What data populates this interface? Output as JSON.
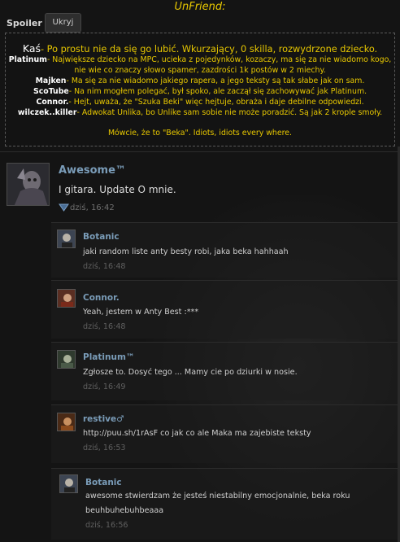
{
  "header": {
    "title": "UnFriend:"
  },
  "spoiler": {
    "label": "Spoiler",
    "button_label": "Ukryj",
    "lines": [
      {
        "name": "Kaś",
        "text": "- Po prostu nie da się go lubić. Wkurzający, 0 skilla, rozwydrzone dziecko."
      },
      {
        "name": "Platinum",
        "text": "- Największe dziecko na MPC, ucieka z pojedynków, kozaczy, ma się za nie wiadomo kogo,"
      },
      {
        "name": "",
        "text": "nie wie co znaczy słowo spamer, zazdrości 1k postów w 2 miechy."
      },
      {
        "name": "Majken",
        "text": "- Ma się za nie wiadomo jakiego rapera, a jego teksty są tak słabe jak on sam."
      },
      {
        "name": "ScoTube",
        "text": "- Na nim mogłem polegać, był spoko, ale zaczął się zachowywać jak Platinum."
      },
      {
        "name": "Connor.",
        "text": "- Hejt, uważa, że \"Szuka Beki\" więc hejtuje, obraża i daje debilne odpowiedzi."
      },
      {
        "name": "wilczek..killer",
        "text": "- Adwokat Unlika, bo Unlike sam sobie nie może poradzić. Są jak 2 krople smoły."
      }
    ],
    "footer": "Mówcie, że to \"Beka\". Idiots, idiots every where."
  },
  "post": {
    "author": "Awesome™",
    "text": "I gitara. Update O mnie.",
    "time": "dziś, 16:42",
    "vote_icon": "vote-arrow-icon"
  },
  "comments": [
    {
      "author": "Botanic",
      "text": [
        "jaki random liste anty besty robi, jaka beka hahhaah"
      ],
      "time": "dziś, 16:48",
      "avatar_color": "#3c4452"
    },
    {
      "author": "Connor.",
      "text": [
        "Yeah, jestem w Anty Best :***"
      ],
      "time": "dziś, 16:48",
      "avatar_color": "#6a3a2a"
    },
    {
      "author": "Platinum™",
      "text": [
        "Zgłosze to. Dosyć tego ... Mamy cie po dziurki w nosie."
      ],
      "time": "dziś, 16:49",
      "avatar_color": "#3d4a3a"
    },
    {
      "author": "restive♂",
      "text": [
        "http://puu.sh/1rAsF co jak co ale Maka ma zajebiste teksty"
      ],
      "time": "dziś, 16:53",
      "avatar_color": "#5a3a22"
    },
    {
      "author": "Botanic",
      "text": [
        "awesome stwierdzam że jesteś niestabilny emocjonalnie, beka roku",
        "beuhbuhebuhbeaaa"
      ],
      "time": "dziś, 16:56",
      "avatar_color": "#3c4452"
    }
  ]
}
